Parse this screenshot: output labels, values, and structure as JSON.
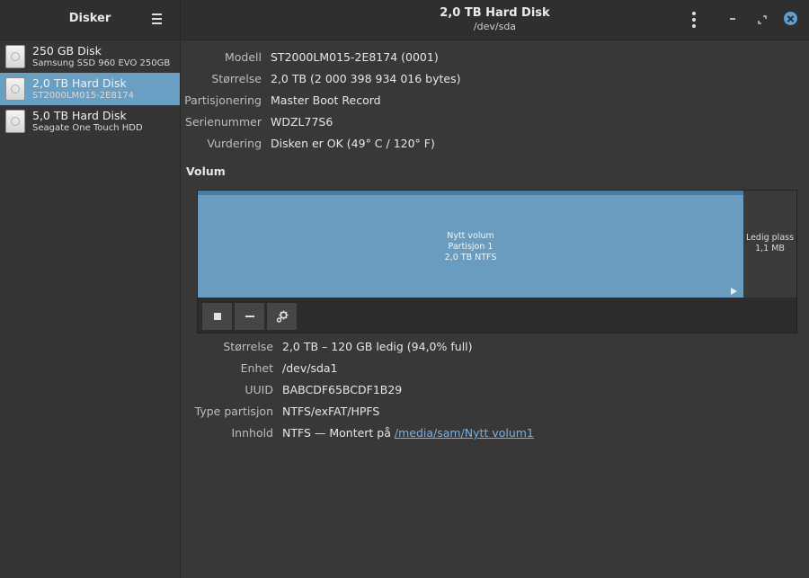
{
  "sidebar": {
    "title": "Disker",
    "menu_icon": "hamburger-menu-icon",
    "items": [
      {
        "name": "250 GB Disk",
        "subtitle": "Samsung SSD 960 EVO 250GB"
      },
      {
        "name": "2,0 TB Hard Disk",
        "subtitle": "ST2000LM015-2E8174"
      },
      {
        "name": "5,0 TB Hard Disk",
        "subtitle": "Seagate One Touch HDD"
      }
    ]
  },
  "header": {
    "title": "2,0 TB Hard Disk",
    "subtitle": "/dev/sda",
    "accent_color": "#5d9fd6"
  },
  "disk_info": {
    "model_label": "Modell",
    "model_value": "ST2000LM015-2E8174 (0001)",
    "size_label": "Størrelse",
    "size_value": "2,0 TB (2 000 398 934 016 bytes)",
    "partitioning_label": "Partisjonering",
    "partitioning_value": "Master Boot Record",
    "serial_label": "Serienummer",
    "serial_value": "WDZL77S6",
    "assessment_label": "Vurdering",
    "assessment_value": "Disken er OK (49° C / 120° F)"
  },
  "volumes": {
    "heading": "Volum",
    "partition": {
      "line1": "Nytt volum",
      "line2": "Partisjon 1",
      "line3": "2,0 TB NTFS",
      "color": "#6a9cbf"
    },
    "free": {
      "line1": "Ledig plass",
      "line2": "1,1 MB"
    }
  },
  "volume_info": {
    "size_label": "Størrelse",
    "size_value": "2,0 TB – 120 GB ledig (94,0% full)",
    "device_label": "Enhet",
    "device_value": "/dev/sda1",
    "uuid_label": "UUID",
    "uuid_value": "BABCDF65BCDF1B29",
    "type_label": "Type partisjon",
    "type_value": "NTFS/exFAT/HPFS",
    "contents_label": "Innhold",
    "contents_prefix": "NTFS — Montert på ",
    "contents_link": "/media/sam/Nytt volum1"
  }
}
